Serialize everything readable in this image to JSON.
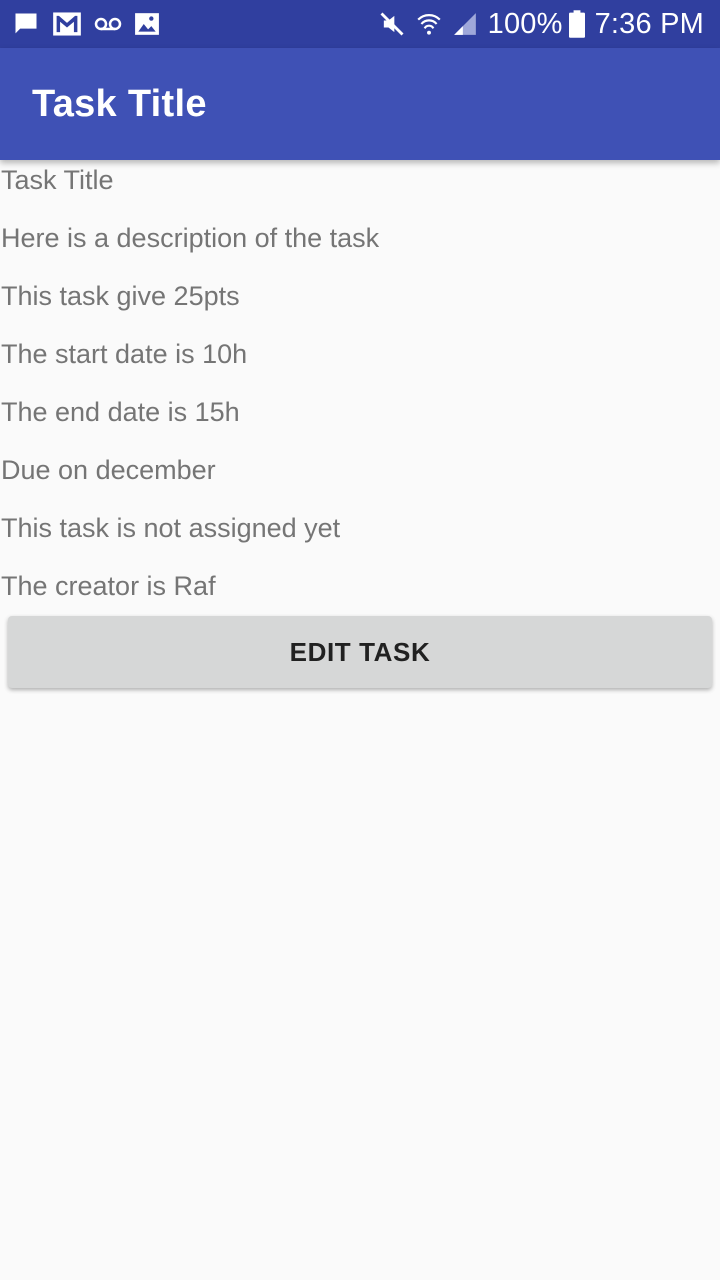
{
  "status_bar": {
    "battery": "100%",
    "time": "7:36 PM",
    "left_icons": [
      "chat-icon",
      "gmail-icon",
      "voicemail-icon",
      "image-icon"
    ],
    "right_icons": [
      "mute-icon",
      "wifi-icon",
      "signal-icon",
      "battery-icon"
    ],
    "color": "#303f9f"
  },
  "app_bar": {
    "title": "Task Title",
    "color": "#3f51b5"
  },
  "task": {
    "title": "Task Title",
    "description": "Here is a description of the task",
    "points": "This task give 25pts",
    "start_date": "The start date is 10h",
    "end_date": "The end date is 15h",
    "due": "Due on december",
    "assignment": "This task is not assigned yet",
    "creator": "The creator is Raf"
  },
  "actions": {
    "edit_label": "EDIT TASK"
  }
}
